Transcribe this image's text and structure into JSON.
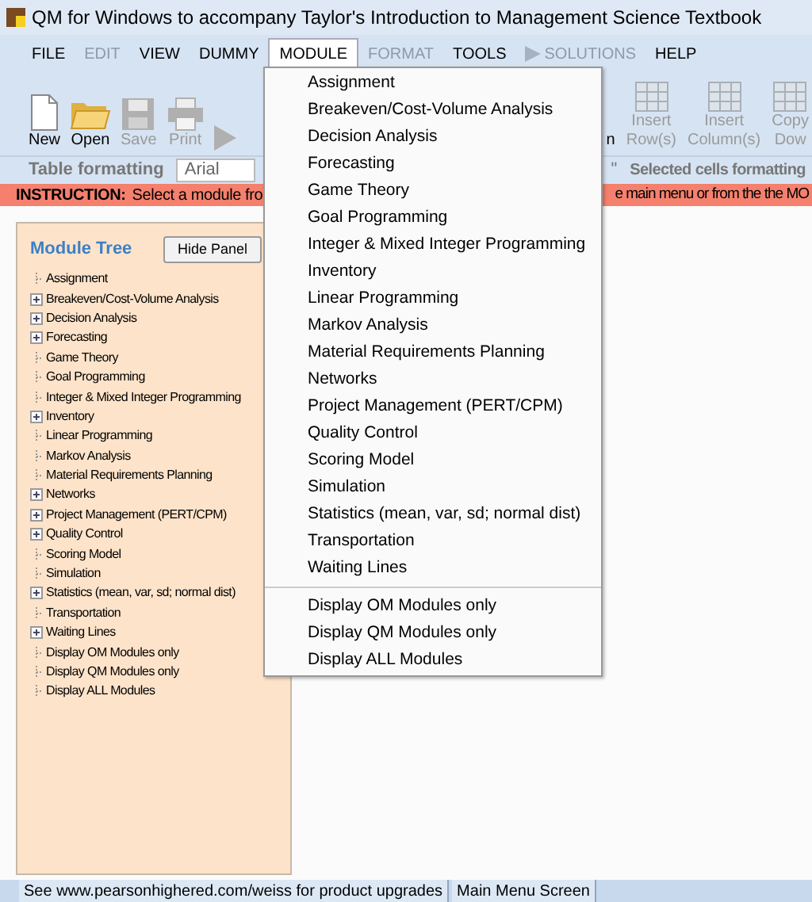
{
  "window": {
    "title": "QM for Windows to accompany Taylor's Introduction to Management Science Textbook"
  },
  "menu": [
    {
      "label": "FILE",
      "disabled": false,
      "selected": false,
      "arrow": false
    },
    {
      "label": "EDIT",
      "disabled": true,
      "selected": false,
      "arrow": false
    },
    {
      "label": "VIEW",
      "disabled": false,
      "selected": false,
      "arrow": false
    },
    {
      "label": "DUMMY",
      "disabled": false,
      "selected": false,
      "arrow": false
    },
    {
      "label": "MODULE",
      "disabled": false,
      "selected": true,
      "arrow": false
    },
    {
      "label": "FORMAT",
      "disabled": true,
      "selected": false,
      "arrow": false
    },
    {
      "label": "TOOLS",
      "disabled": false,
      "selected": false,
      "arrow": false
    },
    {
      "label": "SOLUTIONS",
      "disabled": true,
      "selected": false,
      "arrow": true
    },
    {
      "label": "HELP",
      "disabled": false,
      "selected": false,
      "arrow": false
    }
  ],
  "toolbar_left": [
    {
      "kind": "new",
      "label": "New",
      "disabled": false
    },
    {
      "kind": "open",
      "label": "Open",
      "disabled": false
    },
    {
      "kind": "save",
      "label": "Save",
      "disabled": true
    },
    {
      "kind": "print",
      "label": "Print",
      "disabled": true
    },
    {
      "kind": "play",
      "disabled": true
    }
  ],
  "toolbar_right": [
    {
      "kind": "partial",
      "label": "n",
      "disabled": false
    },
    {
      "kind": "insert-row",
      "label": "Insert Row(s)",
      "disabled": true
    },
    {
      "kind": "insert-column",
      "label": "Insert Column(s)",
      "disabled": true
    },
    {
      "kind": "copy",
      "label": "Copy Dow",
      "disabled": true
    }
  ],
  "format_bar": {
    "label": "Table formatting",
    "font_value": "Arial",
    "right_mark": "\"",
    "right_label": "Selected cells formatting"
  },
  "instruction": {
    "label": "INSTRUCTION:",
    "text_left": "Select a module fro",
    "text_right": "e main menu or from the the MO"
  },
  "module_tree": {
    "title": "Module Tree",
    "hide_button": "Hide Panel",
    "items": [
      {
        "label": "Assignment",
        "collapsed": false
      },
      {
        "label": "Breakeven/Cost-Volume Analysis",
        "collapsed": true
      },
      {
        "label": "Decision Analysis",
        "collapsed": true
      },
      {
        "label": "Forecasting",
        "collapsed": true
      },
      {
        "label": "Game Theory",
        "collapsed": false
      },
      {
        "label": "Goal Programming",
        "collapsed": false
      },
      {
        "label": "Integer & Mixed Integer Programming",
        "collapsed": false
      },
      {
        "label": "Inventory",
        "collapsed": true
      },
      {
        "label": "Linear Programming",
        "collapsed": false
      },
      {
        "label": "Markov Analysis",
        "collapsed": false
      },
      {
        "label": "Material Requirements Planning",
        "collapsed": false
      },
      {
        "label": "Networks",
        "collapsed": true
      },
      {
        "label": "Project Management (PERT/CPM)",
        "collapsed": true
      },
      {
        "label": "Quality Control",
        "collapsed": true
      },
      {
        "label": "Scoring Model",
        "collapsed": false
      },
      {
        "label": "Simulation",
        "collapsed": false
      },
      {
        "label": "Statistics (mean, var, sd; normal dist)",
        "collapsed": true
      },
      {
        "label": "Transportation",
        "collapsed": false
      },
      {
        "label": "Waiting Lines",
        "collapsed": true
      },
      {
        "label": "Display OM Modules only",
        "collapsed": false
      },
      {
        "label": "Display QM Modules only",
        "collapsed": false
      },
      {
        "label": "Display ALL Modules",
        "collapsed": false
      }
    ]
  },
  "module_menu": [
    [
      "Assignment",
      "Breakeven/Cost-Volume Analysis",
      "Decision Analysis",
      "Forecasting",
      "Game Theory",
      "Goal Programming",
      "Integer & Mixed Integer Programming",
      "Inventory",
      "Linear Programming",
      "Markov Analysis",
      "Material Requirements Planning",
      "Networks",
      "Project Management (PERT/CPM)",
      "Quality Control",
      "Scoring Model",
      "Simulation",
      "Statistics (mean, var, sd; normal dist)",
      "Transportation",
      "Waiting Lines"
    ],
    [
      "Display OM Modules only",
      "Display QM Modules only",
      "Display ALL Modules"
    ]
  ],
  "status_bar": [
    "See www.pearsonhighered.com/weiss for product upgrades",
    "Main Menu Screen"
  ]
}
